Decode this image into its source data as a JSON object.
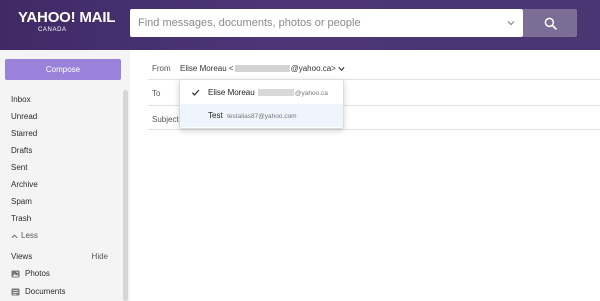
{
  "header": {
    "logo_main": "YAHOO! MAIL",
    "logo_sub": "CANADA",
    "search_placeholder": "Find messages, documents, photos or people"
  },
  "sidebar": {
    "compose_label": "Compose",
    "items": [
      "Inbox",
      "Unread",
      "Starred",
      "Drafts",
      "Sent",
      "Archive",
      "Spam",
      "Trash"
    ],
    "less_label": "Less",
    "views_label": "Views",
    "hide_label": "Hide",
    "folders": [
      {
        "label": "Photos",
        "icon": "photo-icon"
      },
      {
        "label": "Documents",
        "icon": "document-icon"
      }
    ]
  },
  "compose": {
    "from_label": "From",
    "from_name": "Elise Moreau <",
    "from_domain": "@yahoo.ca>",
    "to_label": "To",
    "subject_label": "Subject"
  },
  "from_dropdown": {
    "items": [
      {
        "name": "Elise Moreau",
        "email_suffix": "@yahoo.ca",
        "selected": true
      },
      {
        "name": "Test",
        "email": "testalias87@yahoo.com",
        "selected": false
      }
    ]
  },
  "colors": {
    "header": "#4a3672",
    "compose_button": "#9a82da",
    "search_button": "#7b6d95",
    "sidebar": "#f4f4f4"
  }
}
